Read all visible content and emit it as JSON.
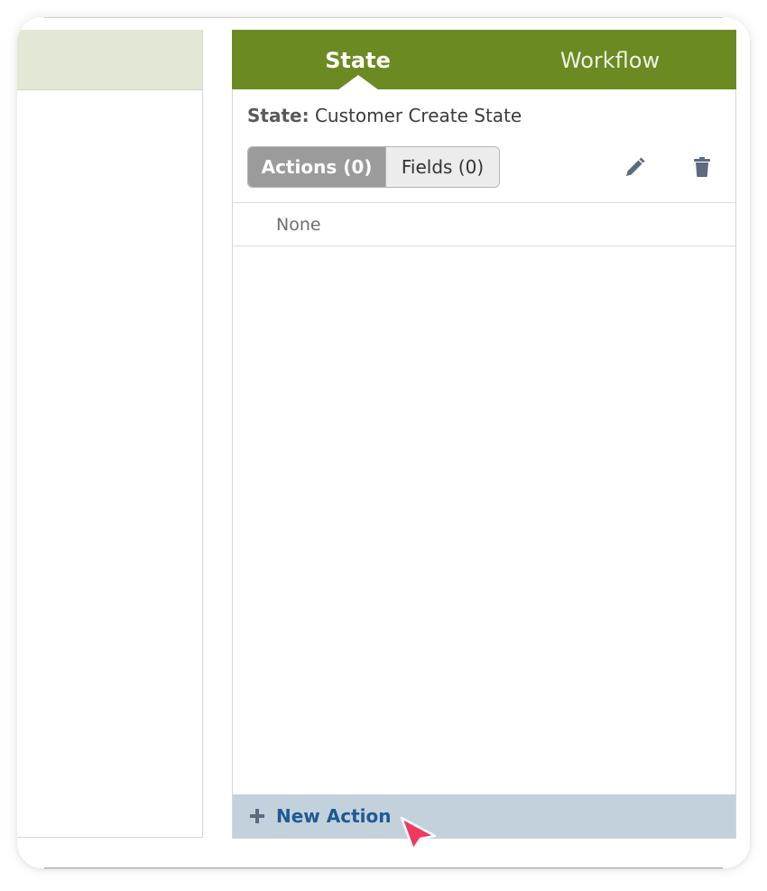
{
  "tabs": {
    "state": "State",
    "workflow": "Workflow"
  },
  "state_info": {
    "label": "State:",
    "name": "Customer Create State"
  },
  "segments": {
    "actions": "Actions (0)",
    "fields": "Fields (0)",
    "selected": "Actions (0)"
  },
  "list": {
    "empty_text": "None"
  },
  "footer": {
    "new_action": "New Action"
  },
  "icons": {
    "edit": "pencil-icon",
    "delete": "trash-icon",
    "add": "plus-icon",
    "cursor": "mouse-cursor"
  },
  "colors": {
    "tab_bar": "#6b8a22",
    "left_header": "#e2e7d6",
    "segment_active": "#9b9b9b",
    "footer_bg": "#c3d1dd",
    "footer_text": "#1e5a93",
    "icon": "#5c6b7e",
    "cursor": "#ee3a5f"
  }
}
